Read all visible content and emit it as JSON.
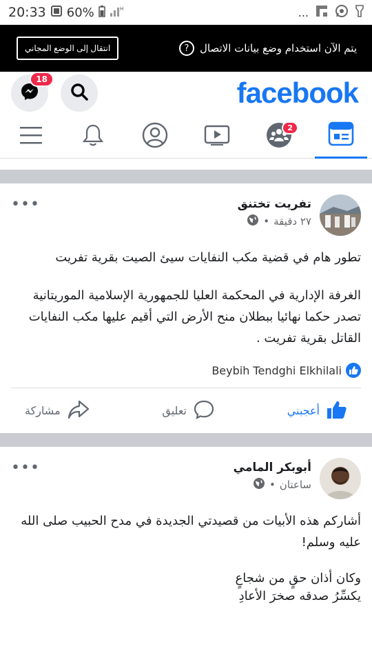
{
  "status": {
    "time": "20:33",
    "battery": "60%",
    "dots": "..."
  },
  "banner": {
    "text": "يتم الآن استخدام وضع بيانات الاتصال",
    "help": "?",
    "button": "انتقال إلى الوضع المجاني"
  },
  "header": {
    "logo": "facebook",
    "messenger_badge": "18",
    "groups_badge": "2"
  },
  "posts": [
    {
      "author": "تفريت تختنق",
      "time": "٢٧ دقيقة",
      "paragraphs": [
        "تطور هام في قضية مكب النفايات سيئ الصيت بقرية تفريت",
        "الغرفة الإدارية في المحكمة العليا للجمهورية الإسلامية الموريتانية تصدر حكما نهائيا ببطلان منح الأرض التي أقيم عليها مكب النفايات القاتل بقرية تفريت ."
      ],
      "liked_by": "Beybih Tendghi Elkhilali",
      "actions": {
        "like": "أعجبني",
        "comment": "تعليق",
        "share": "مشاركة"
      }
    },
    {
      "author": "أبوبكر المامي",
      "time": "ساعتان",
      "paragraphs": [
        "أشاركم هذه الأبيات من قصيدتي الجديدة في مدح الحبيب صلى الله عليه وسلم!",
        "وكان أذان حقٍ من شجاعٍ\nيكسِّرُ صدقه صخرَ الأعادِ"
      ]
    }
  ],
  "colors": {
    "brand": "#1877f2",
    "badge": "#f02849"
  }
}
